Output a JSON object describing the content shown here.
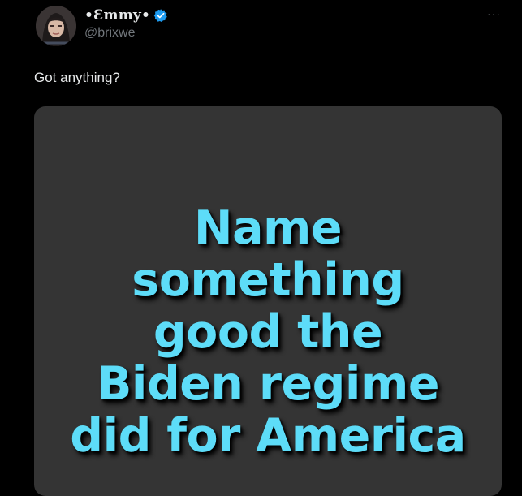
{
  "tweet": {
    "author": {
      "display_name": "•Ɛmmy•",
      "handle": "@brixwe",
      "verified": true,
      "verified_color": "#1d9bf0",
      "avatar_icon": "avatar-photo"
    },
    "more_label": "···",
    "text": "Got anything?",
    "media": {
      "background_color": "#343434",
      "text_color": "#5ddcf8",
      "lines": [
        "Name",
        "something",
        "good the",
        "Biden regime",
        "did for America"
      ]
    }
  }
}
